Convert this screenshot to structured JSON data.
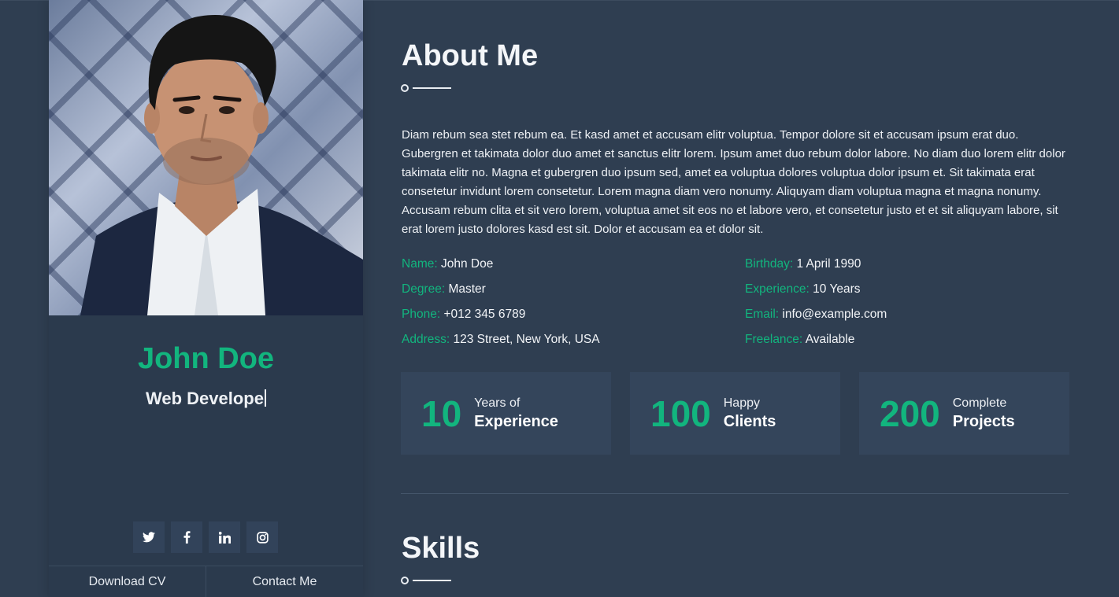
{
  "sidebar": {
    "name": "John Doe",
    "role_typed": "Web Develope",
    "socials": [
      {
        "icon": "twitter-icon",
        "glyph": "t"
      },
      {
        "icon": "facebook-icon",
        "glyph": "f"
      },
      {
        "icon": "linkedin-icon",
        "glyph": "in"
      },
      {
        "icon": "instagram-icon",
        "glyph": "◎"
      }
    ],
    "download_cv": "Download CV",
    "contact_me": "Contact Me"
  },
  "about": {
    "title": "About Me",
    "text": "Diam rebum sea stet rebum ea. Et kasd amet et accusam elitr voluptua. Tempor dolore sit et accusam ipsum erat duo. Gubergren et takimata dolor duo amet et sanctus elitr lorem. Ipsum amet duo rebum dolor labore. No diam duo lorem elitr dolor takimata elitr no. Magna et gubergren duo ipsum sed, amet ea voluptua dolores voluptua dolor ipsum et. Sit takimata erat consetetur invidunt lorem consetetur. Lorem magna diam vero nonumy. Aliquyam diam voluptua magna et magna nonumy. Accusam rebum clita et sit vero lorem, voluptua amet sit eos no et labore vero, et consetetur justo et et sit aliquyam labore, sit erat lorem justo dolores kasd est sit. Dolor et accusam ea et dolor sit."
  },
  "info": [
    {
      "label": "Name:",
      "value": "John Doe"
    },
    {
      "label": "Birthday:",
      "value": "1 April 1990"
    },
    {
      "label": "Degree:",
      "value": "Master"
    },
    {
      "label": "Experience:",
      "value": "10 Years"
    },
    {
      "label": "Phone:",
      "value": "+012 345 6789"
    },
    {
      "label": "Email:",
      "value": "info@example.com"
    },
    {
      "label": "Address:",
      "value": "123 Street, New York, USA"
    },
    {
      "label": "Freelance:",
      "value": "Available"
    }
  ],
  "stats": [
    {
      "number": "10",
      "small": "Years of",
      "big": "Experience"
    },
    {
      "number": "100",
      "small": "Happy",
      "big": "Clients"
    },
    {
      "number": "200",
      "small": "Complete",
      "big": "Projects"
    }
  ],
  "skills": {
    "title": "Skills"
  },
  "colors": {
    "accent": "#12b57e",
    "background": "#2f3e51",
    "sidebar": "#2b3a4d",
    "card": "#34455b"
  }
}
